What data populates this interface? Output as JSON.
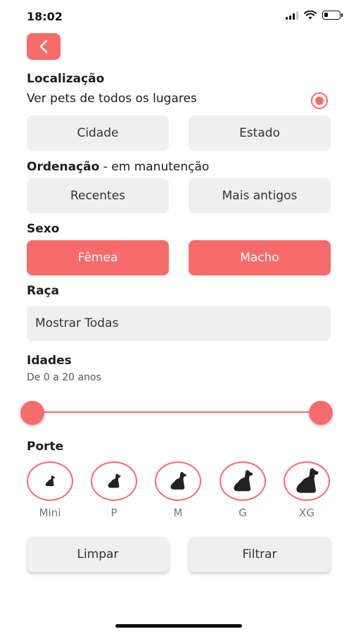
{
  "status_bar": {
    "time": "18:02"
  },
  "localizacao": {
    "title": "Localização",
    "subtitle": "Ver pets de todos os lugares",
    "options": [
      "Cidade",
      "Estado"
    ]
  },
  "ordenacao": {
    "title": "Ordenação",
    "note": " - em manutenção",
    "options": [
      "Recentes",
      "Mais antigos"
    ]
  },
  "sexo": {
    "title": "Sexo",
    "options": [
      "Fêmea",
      "Macho"
    ]
  },
  "raca": {
    "title": "Raça",
    "value": "Mostrar Todas"
  },
  "idades": {
    "title": "Idades",
    "range_text": "De 0 a 20 anos",
    "min": 0,
    "max": 20
  },
  "porte": {
    "title": "Porte",
    "sizes": [
      "Mini",
      "P",
      "M",
      "G",
      "XG"
    ]
  },
  "actions": {
    "clear": "Limpar",
    "filter": "Filtrar"
  },
  "colors": {
    "accent": "#f76b6b",
    "button_gray": "#efefef"
  },
  "icons": {
    "back": "chevron-left-icon",
    "size": "dog-icon"
  }
}
